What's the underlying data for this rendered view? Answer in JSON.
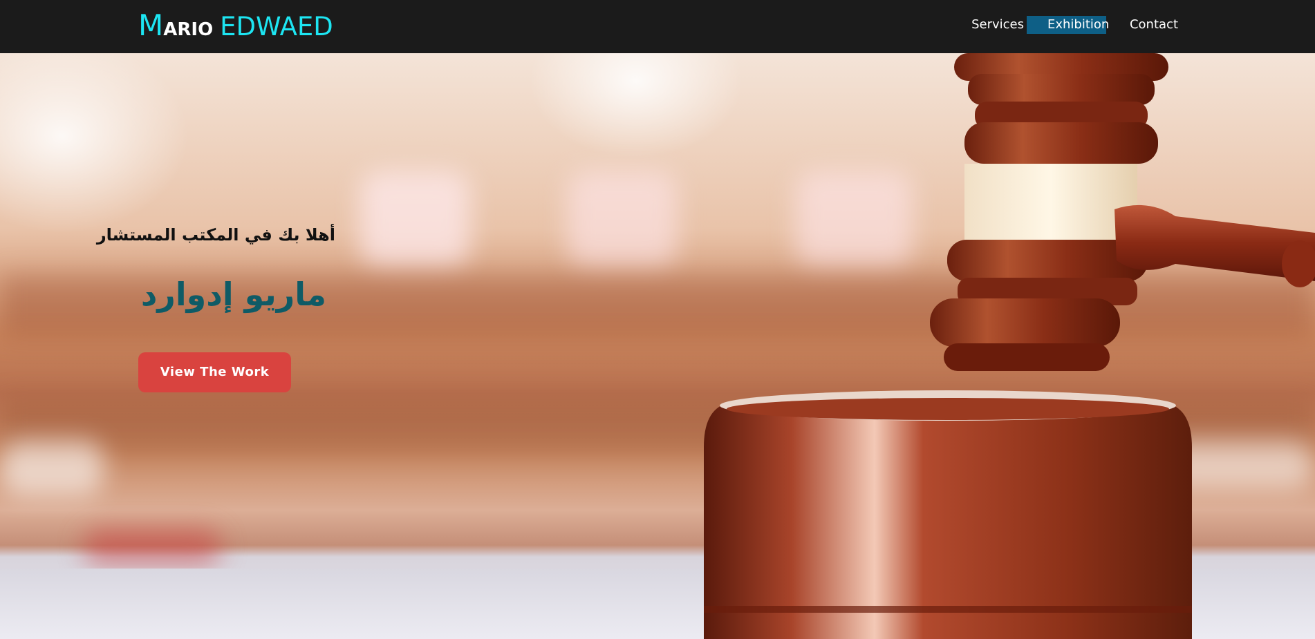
{
  "logo": {
    "first_initial": "M",
    "first_rest": "ARIO",
    "last": "EDWAED",
    "accent_color": "#1de5f2"
  },
  "nav": {
    "items": [
      {
        "label": "Services"
      },
      {
        "label": "Exhibition"
      },
      {
        "label": "Contact"
      }
    ],
    "active_bg": "#0e5f86"
  },
  "hero": {
    "welcome": "أهلا بك في المكتب المستشار",
    "name": "ماريو إدوارد",
    "cta_label": "View The Work",
    "cta_color": "#d9433f",
    "name_color": "#0f5b66",
    "background_icon": "gavel-photo"
  }
}
